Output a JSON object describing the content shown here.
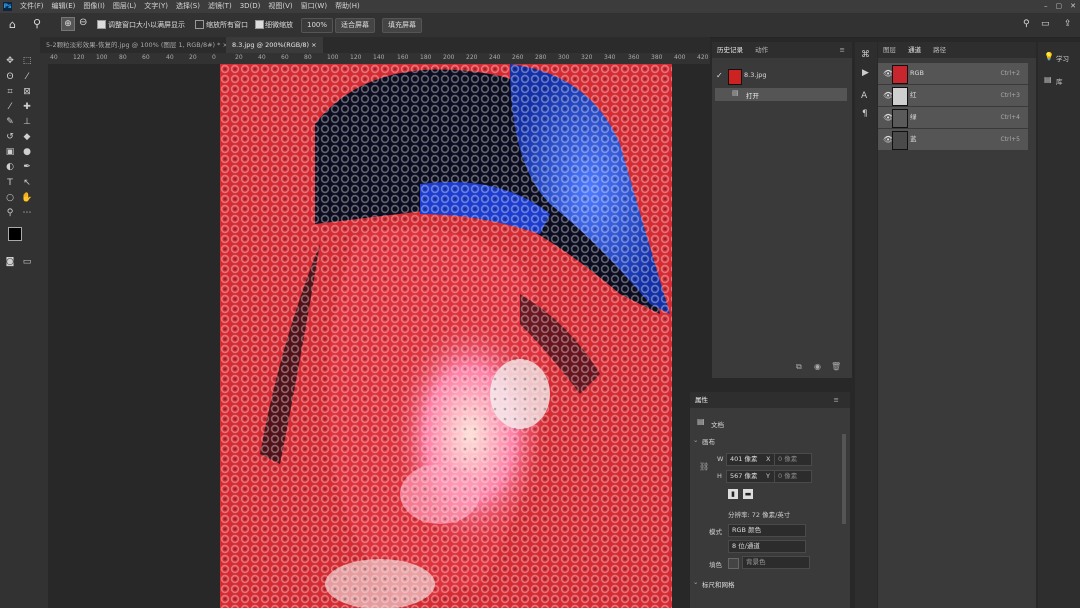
{
  "app": {
    "logo": "Ps"
  },
  "menu": [
    "文件(F)",
    "编辑(E)",
    "图像(I)",
    "图层(L)",
    "文字(Y)",
    "选择(S)",
    "滤镜(T)",
    "3D(D)",
    "视图(V)",
    "窗口(W)",
    "帮助(H)"
  ],
  "window_buttons": [
    "–",
    "▢",
    "✕"
  ],
  "options": {
    "resize_windows": "调整窗口大小以满屏显示",
    "zoom_all": "缩放所有窗口",
    "scrubby_zoom": "细微缩放",
    "zoom_level": "100%",
    "fit_screen": "适合屏幕",
    "fill_screen": "填充屏幕"
  },
  "tabs": [
    {
      "label": "5-2颗粒淡彩效果-恢复的.jpg @ 100% (图层 1, RGB/8#) *",
      "close": "×"
    },
    {
      "label": "8.3.jpg @ 200%(RGB/8)",
      "close": "×"
    }
  ],
  "ruler_ticks": [
    "40",
    "120",
    "100",
    "80",
    "60",
    "40",
    "20",
    "0",
    "20",
    "40",
    "60",
    "80",
    "100",
    "120",
    "140",
    "160",
    "180",
    "200",
    "220",
    "240",
    "260",
    "280",
    "300",
    "320",
    "340",
    "360",
    "380",
    "400",
    "420"
  ],
  "history": {
    "tabs": [
      "历史记录",
      "动作"
    ],
    "snapshot": "8.3.jpg",
    "item": "打开"
  },
  "channels": {
    "tabs": [
      "图层",
      "通道",
      "路径"
    ],
    "rows": [
      {
        "name": "RGB",
        "shortcut": "Ctrl+2"
      },
      {
        "name": "红",
        "shortcut": "Ctrl+3"
      },
      {
        "name": "绿",
        "shortcut": "Ctrl+4"
      },
      {
        "name": "蓝",
        "shortcut": "Ctrl+5"
      }
    ]
  },
  "properties": {
    "title": "属性",
    "doc_label": "文档",
    "section_canvas": "画布",
    "w_label": "W",
    "w_value": "401 像素",
    "h_label": "H",
    "h_value": "567 像素",
    "x_label": "X",
    "x_value": "0 像素",
    "y_label": "Y",
    "y_value": "0 像素",
    "resolution": "分辨率: 72 像素/英寸",
    "mode_label": "模式",
    "mode_value": "RGB 颜色",
    "depth_value": "8 位/通道",
    "fill_label": "填色",
    "fill_value": "背景色",
    "section_rulers": "标尺和网格"
  },
  "right_strip": {
    "learn": "学习",
    "library": "库"
  },
  "colors": {
    "accent": "#31a8ff",
    "pixel_red": "#d62b33"
  }
}
